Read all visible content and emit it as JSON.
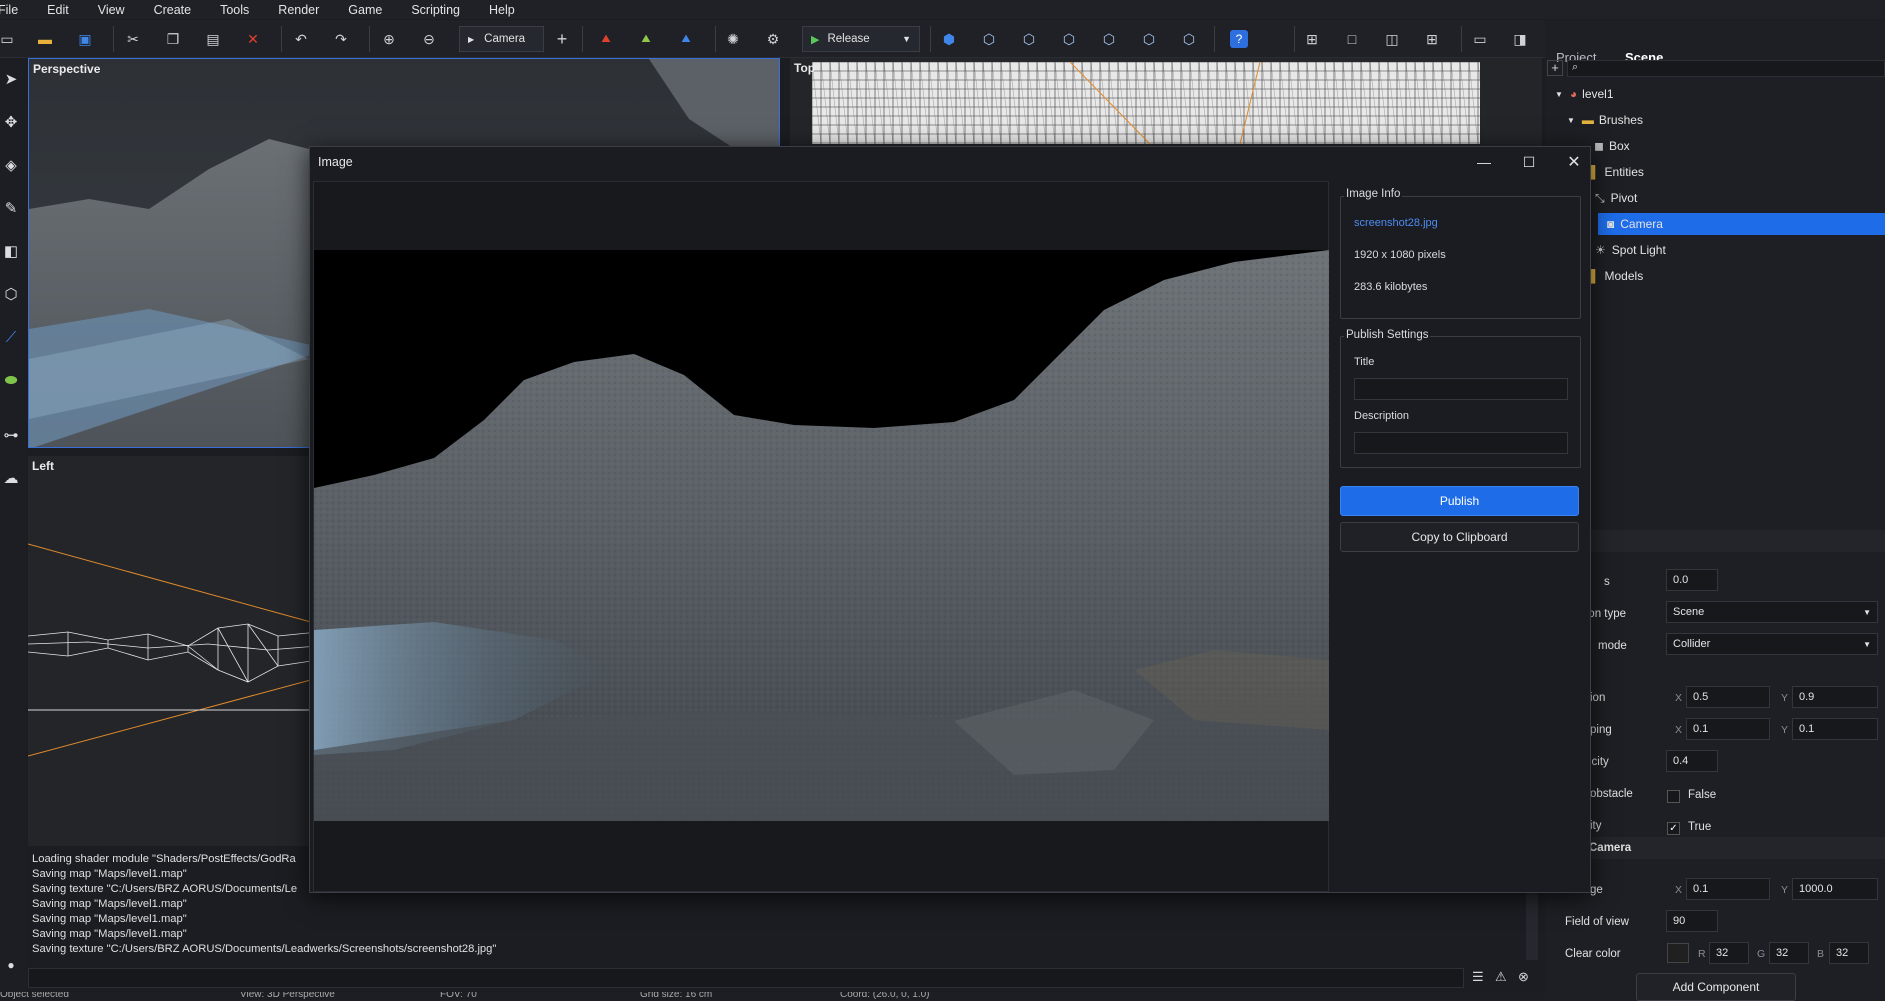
{
  "menu": {
    "items": [
      "File",
      "Edit",
      "View",
      "Create",
      "Tools",
      "Render",
      "Game",
      "Scripting",
      "Help"
    ]
  },
  "toolbar": {
    "camera_label": "Camera",
    "release_label": "Release"
  },
  "viewports": {
    "perspective": "Perspective",
    "top": "Top",
    "left": "Left"
  },
  "console": {
    "lines": [
      "Loading shader module \"Shaders/PostEffects/GodRa",
      "Saving map \"Maps/level1.map\"",
      "Saving texture \"C:/Users/BRZ AORUS/Documents/Le",
      "Saving map \"Maps/level1.map\"",
      "Saving map \"Maps/level1.map\"",
      "Saving map \"Maps/level1.map\"",
      "Saving texture \"C:/Users/BRZ AORUS/Documents/Leadwerks/Screenshots/screenshot28.jpg\""
    ]
  },
  "statusbar": {
    "selection": "Object selected",
    "view": "View: 3D Perspective",
    "fov": "FOV: 70",
    "grid": "Grid size: 16 cm",
    "coords": "Coord: (26.0, 0, 1.0)"
  },
  "panel": {
    "tabs": [
      "Project",
      "Scene"
    ],
    "active_tab": "Scene",
    "search_placeholder": "",
    "tree": [
      {
        "label": "level1"
      },
      {
        "label": "Brushes"
      },
      {
        "label": "Box"
      },
      {
        "label": "Entities"
      },
      {
        "label": "Pivot"
      },
      {
        "label": "Camera",
        "selected": true
      },
      {
        "label": "Spot Light"
      },
      {
        "label": "Models"
      }
    ],
    "props": {
      "mass_label": "s",
      "mass_value": "0.0",
      "collision_label": "sion type",
      "collision_value": "Scene",
      "nav_label": "mode",
      "nav_value": "Collider",
      "friction_label": "ion",
      "friction_x": "0.5",
      "friction_y": "0.9",
      "damping_label": "ping",
      "damping_x": "0.1",
      "damping_y": "0.1",
      "elasticity_label": "icity",
      "elasticity_value": "0.4",
      "obstacle_label": "obstacle",
      "obstacle_value": "False",
      "gravity_label": "ity",
      "gravity_value": "True",
      "camera_section": "Camera",
      "range_label": "ge",
      "range_x": "0.1",
      "range_y": "1000.0",
      "fov_label": "Field of view",
      "fov_value": "90",
      "clear_label": "Clear color",
      "clear_r": "32",
      "clear_g": "32",
      "clear_b": "32",
      "add_component": "Add Component"
    }
  },
  "dialog": {
    "title": "Image",
    "image_info_label": "Image Info",
    "filename": "screenshot28.jpg",
    "dimensions": "1920 x 1080 pixels",
    "filesize": "283.6 kilobytes",
    "publish_settings_label": "Publish Settings",
    "title_label": "Title",
    "title_value": "",
    "description_label": "Description",
    "description_value": "",
    "publish_button": "Publish",
    "copy_button": "Copy to Clipboard"
  },
  "colors": {
    "accent": "#1e6ce8",
    "selected": "#1e6ce8",
    "link": "#4c8cf0",
    "grid_orange": "#e08a2c"
  }
}
